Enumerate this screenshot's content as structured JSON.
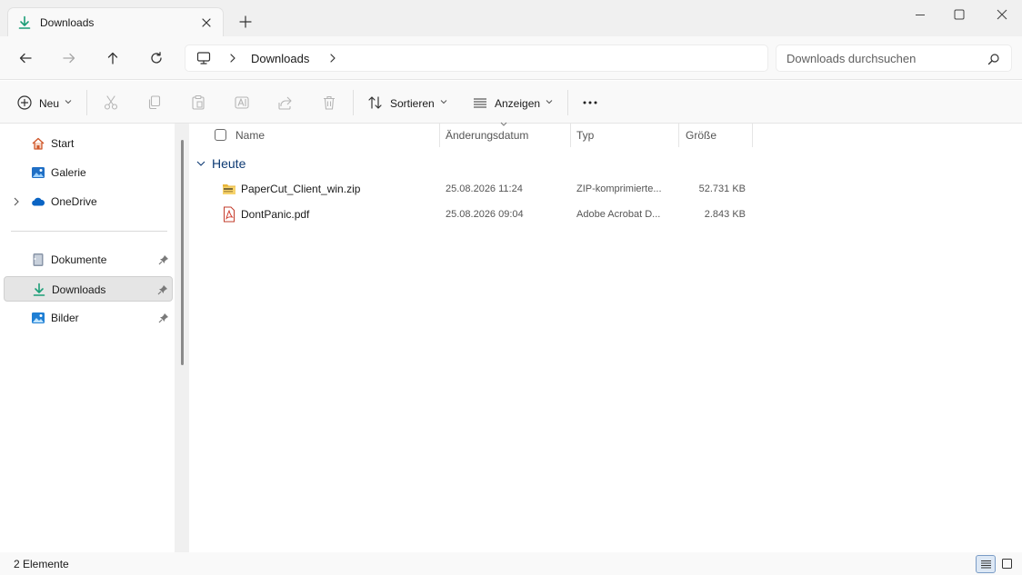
{
  "window": {
    "tab_title": "Downloads",
    "tab_icon": "download-arrow-icon",
    "accent": "#1b9e77"
  },
  "address": {
    "breadcrumb": "Downloads",
    "search_placeholder": "Downloads durchsuchen"
  },
  "commands": {
    "new_label": "Neu",
    "sort_label": "Sortieren",
    "view_label": "Anzeigen",
    "more_label": "···"
  },
  "navpane": {
    "items": [
      {
        "label": "Start",
        "icon": "home-icon"
      },
      {
        "label": "Galerie",
        "icon": "gallery-icon"
      },
      {
        "label": "OneDrive",
        "icon": "cloud-icon"
      }
    ],
    "pinned": [
      {
        "label": "Dokumente",
        "icon": "document-icon"
      },
      {
        "label": "Downloads",
        "icon": "download-arrow-icon",
        "selected": true
      },
      {
        "label": "Bilder",
        "icon": "pictures-icon"
      }
    ]
  },
  "columns": {
    "name": "Name",
    "date": "Änderungsdatum",
    "type": "Typ",
    "size": "Größe"
  },
  "group": {
    "label": "Heute"
  },
  "files": [
    {
      "name": "PaperCut_Client_win.zip",
      "date": "25.08.2026 11:24",
      "type": "ZIP-komprimierte...",
      "size": "52.731 KB",
      "icon": "zip-folder-icon"
    },
    {
      "name": "DontPanic.pdf",
      "date": "25.08.2026 09:04",
      "type": "Adobe Acrobat D...",
      "size": "2.843 KB",
      "icon": "pdf-icon"
    }
  ],
  "status": {
    "count": "2 Elemente"
  }
}
